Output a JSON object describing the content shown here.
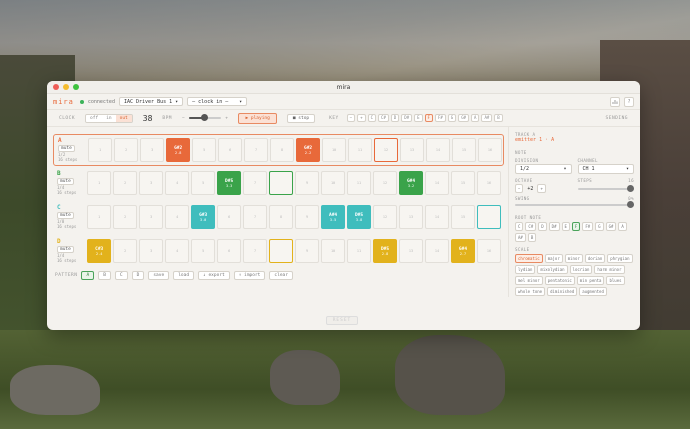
{
  "window": {
    "title": "mira"
  },
  "header": {
    "brand": "mira",
    "status": "connected",
    "midi_port": "IAC Driver Bus 1",
    "clock_select": "— clock in —",
    "icon_left": "chart-icon",
    "icon_right": "help-icon",
    "help_label": "?"
  },
  "transport": {
    "clock_label": "CLOCK",
    "clock_options": [
      "off",
      "in",
      "out"
    ],
    "clock_selected": "out",
    "bpm_value": "38",
    "bpm_label": "BPM",
    "minus": "−",
    "plus": "+",
    "play_label": "▶ playing",
    "stop_label": "■ stop",
    "key_label": "KEY",
    "sending_label": "SENDING",
    "tempo_level": 0.45
  },
  "keys": [
    "−",
    "+",
    "C",
    "C#",
    "D",
    "D#",
    "E",
    "F",
    "F#",
    "G",
    "G#",
    "A",
    "A#",
    "B"
  ],
  "tracks": [
    {
      "letter": "A",
      "color": "#e8693a",
      "mute": "mute",
      "div": "1/2",
      "len": "16 steps",
      "steps": [
        {
          "n": "1"
        },
        {
          "n": "2"
        },
        {
          "n": "3"
        },
        {
          "n": "",
          "note": "G#2",
          "vel": "2.8",
          "on": true
        },
        {
          "n": "5"
        },
        {
          "n": "6"
        },
        {
          "n": "7"
        },
        {
          "n": "8"
        },
        {
          "n": "",
          "note": "G#2",
          "vel": "2.2",
          "on": true
        },
        {
          "n": "10"
        },
        {
          "n": "11"
        },
        {
          "n": "12",
          "outline": true
        },
        {
          "n": "13"
        },
        {
          "n": "14"
        },
        {
          "n": "15"
        },
        {
          "n": "16"
        }
      ]
    },
    {
      "letter": "B",
      "color": "#3aa34a",
      "mute": "mute",
      "div": "1/4",
      "len": "16 steps",
      "steps": [
        {
          "n": "1"
        },
        {
          "n": "2"
        },
        {
          "n": "3"
        },
        {
          "n": "4"
        },
        {
          "n": "5"
        },
        {
          "n": "",
          "note": "D#5",
          "vel": "3.3",
          "on": true
        },
        {
          "n": "7"
        },
        {
          "n": "",
          "outline": true
        },
        {
          "n": "9"
        },
        {
          "n": "10"
        },
        {
          "n": "11"
        },
        {
          "n": "12"
        },
        {
          "n": "",
          "note": "G#4",
          "vel": "3.2",
          "on": true
        },
        {
          "n": "14"
        },
        {
          "n": "15"
        },
        {
          "n": "16"
        }
      ]
    },
    {
      "letter": "C",
      "color": "#3fbdbd",
      "mute": "mute",
      "div": "1/8",
      "len": "16 steps",
      "steps": [
        {
          "n": "1"
        },
        {
          "n": "2"
        },
        {
          "n": "3"
        },
        {
          "n": "4"
        },
        {
          "n": "",
          "note": "G#3",
          "vel": "3.0",
          "on": true
        },
        {
          "n": "6"
        },
        {
          "n": "7"
        },
        {
          "n": "8"
        },
        {
          "n": "9"
        },
        {
          "n": "",
          "note": "A#4",
          "vel": "3.5",
          "on": true
        },
        {
          "n": "",
          "note": "D#5",
          "vel": "3.8",
          "on": true
        },
        {
          "n": "12"
        },
        {
          "n": "13"
        },
        {
          "n": "14"
        },
        {
          "n": "15"
        },
        {
          "n": "",
          "outline": true
        }
      ]
    },
    {
      "letter": "D",
      "color": "#e2b21c",
      "mute": "mute",
      "div": "1/4",
      "len": "16 steps",
      "steps": [
        {
          "n": "",
          "note": "C#3",
          "vel": "2.4",
          "on": true
        },
        {
          "n": "2"
        },
        {
          "n": "3"
        },
        {
          "n": "4"
        },
        {
          "n": "5"
        },
        {
          "n": "6"
        },
        {
          "n": "7"
        },
        {
          "n": "",
          "outline": true
        },
        {
          "n": "9"
        },
        {
          "n": "10"
        },
        {
          "n": "11"
        },
        {
          "n": "",
          "note": "D#5",
          "vel": "2.8",
          "on": true
        },
        {
          "n": "13"
        },
        {
          "n": "14"
        },
        {
          "n": "",
          "note": "G#4",
          "vel": "2.7",
          "on": true
        },
        {
          "n": "16"
        }
      ]
    }
  ],
  "pattern": {
    "label": "PATTERN",
    "slots": [
      "A",
      "B",
      "C",
      "D"
    ],
    "selected": "A",
    "save": "save",
    "load": "load",
    "export": "↓ export",
    "import": "↑ import",
    "clear": "clear"
  },
  "panel": {
    "track_label": "TRACK A",
    "track_name": "emitter 1 · A",
    "note_label": "NOTE",
    "division_label": "DIVISION",
    "division_value": "1/2",
    "channel_label": "CHANNEL",
    "channel_value": "CH 1",
    "octave_label": "OCTAVE",
    "octave_value": "+2",
    "octave_minus": "−",
    "octave_plus": "+",
    "steps_label": "STEPS",
    "steps_value": "16",
    "swing_label": "SWING",
    "swing_value": "0%",
    "root_label": "ROOT NOTE",
    "root_notes": [
      "C",
      "C#",
      "D",
      "D#",
      "E",
      "F",
      "F#",
      "G",
      "G#",
      "A",
      "A#",
      "B"
    ],
    "root_selected": "F",
    "scale_label": "SCALE",
    "scales": [
      "chromatic",
      "major",
      "minor",
      "dorian",
      "phrygian",
      "lydian",
      "mixolydian",
      "locrian",
      "harm minor",
      "mel minor",
      "pentatonic",
      "min penta",
      "blues",
      "whole tone",
      "diminished",
      "augmented"
    ],
    "scale_selected": "chromatic"
  },
  "footer": {
    "button": "RESET"
  },
  "colors": {
    "accent": "#e8693a",
    "green": "#3aa34a",
    "teal": "#3fbdbd",
    "yellow": "#e2b21c"
  }
}
